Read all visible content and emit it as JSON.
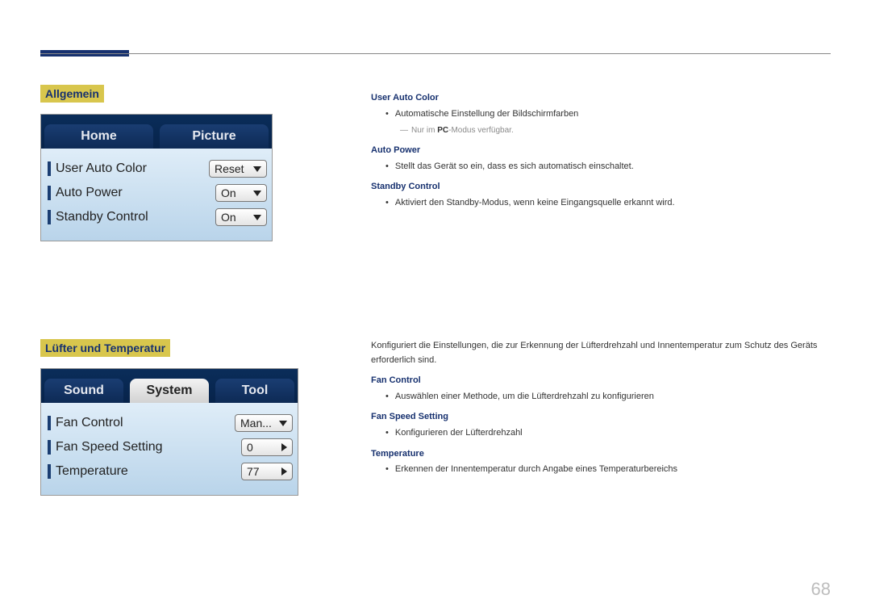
{
  "pageNumber": "68",
  "section1": {
    "heading": "Allgemein",
    "tabs": {
      "home": "Home",
      "picture": "Picture"
    },
    "rows": [
      {
        "label": "User Auto Color",
        "value": "Reset",
        "kind": "down"
      },
      {
        "label": "Auto Power",
        "value": "On",
        "kind": "down"
      },
      {
        "label": "Standby Control",
        "value": "On",
        "kind": "down"
      }
    ]
  },
  "section2": {
    "heading": "Lüfter und Temperatur",
    "tabs": {
      "sound": "Sound",
      "system": "System",
      "tool": "Tool"
    },
    "rows": [
      {
        "label": "Fan Control",
        "value": "Man...",
        "kind": "down"
      },
      {
        "label": "Fan Speed Setting",
        "value": "0",
        "kind": "right"
      },
      {
        "label": "Temperature",
        "value": "77",
        "kind": "right"
      }
    ]
  },
  "desc1": {
    "userAutoColor": {
      "head": "User Auto Color",
      "bullet": "Automatische Einstellung der Bildschirmfarben",
      "notePrefix": "―",
      "note1": "Nur im ",
      "noteBold": "PC",
      "note2": "-Modus verfügbar."
    },
    "autoPower": {
      "head": "Auto Power",
      "bullet": "Stellt das Gerät so ein, dass es sich automatisch einschaltet."
    },
    "standbyControl": {
      "head": "Standby Control",
      "bullet": "Aktiviert den Standby-Modus, wenn keine Eingangsquelle erkannt wird."
    }
  },
  "desc2": {
    "intro": "Konfiguriert die Einstellungen, die zur Erkennung der Lüfterdrehzahl und Innentemperatur zum Schutz des Geräts erforderlich sind.",
    "fanControl": {
      "head": "Fan Control",
      "bullet": "Auswählen einer Methode, um die Lüfterdrehzahl zu konfigurieren"
    },
    "fanSpeed": {
      "head": "Fan Speed Setting",
      "bullet": "Konfigurieren der Lüfterdrehzahl"
    },
    "temperature": {
      "head": "Temperature",
      "bullet": "Erkennen der Innentemperatur durch Angabe eines Temperaturbereichs"
    }
  }
}
